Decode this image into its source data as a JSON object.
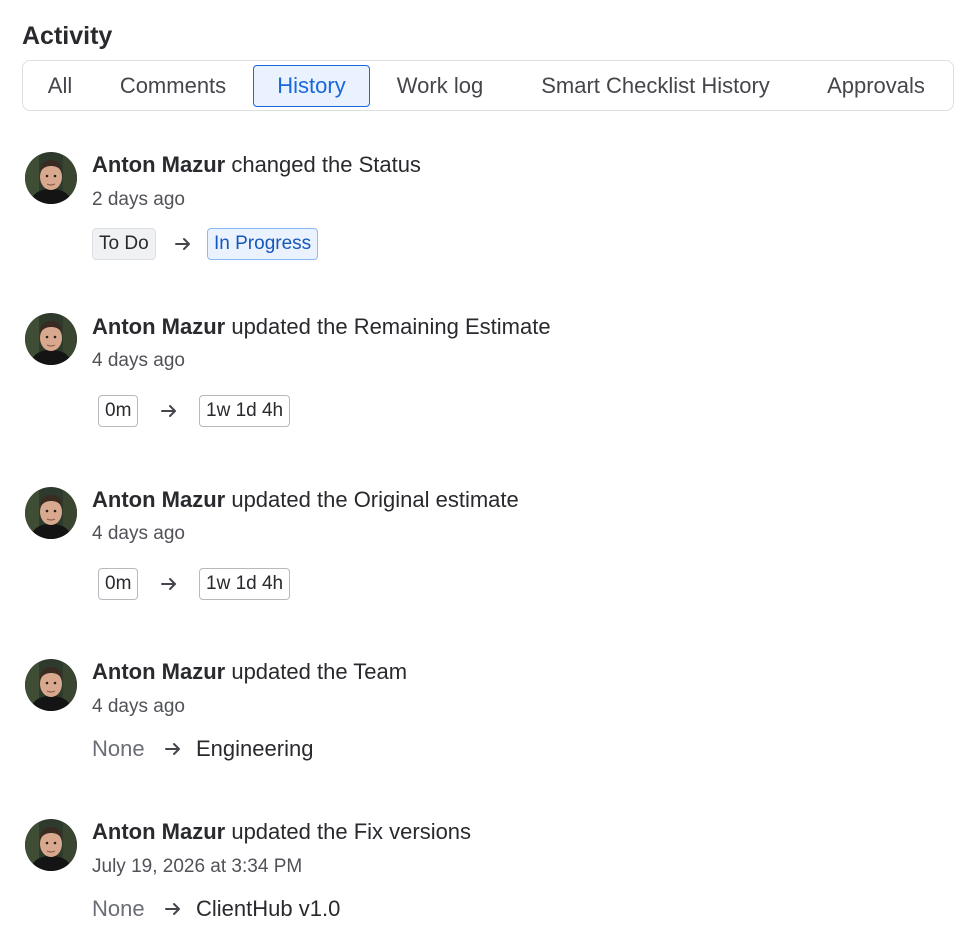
{
  "activity": {
    "title": "Activity",
    "tabs": [
      {
        "label": "All"
      },
      {
        "label": "Comments"
      },
      {
        "label": "History"
      },
      {
        "label": "Work log"
      },
      {
        "label": "Smart Checklist History"
      },
      {
        "label": "Approvals"
      }
    ],
    "active_tab": "History"
  },
  "entries": [
    {
      "actor": "Anton Mazur",
      "action": "changed the",
      "field": "Status",
      "time": "2 days ago",
      "from": "To Do",
      "to": "In Progress"
    },
    {
      "actor": "Anton Mazur",
      "action": "updated the",
      "field": "Remaining Estimate",
      "time": "4 days ago",
      "from": "0m",
      "to": "1w 1d 4h"
    },
    {
      "actor": "Anton Mazur",
      "action": "updated the",
      "field": "Original estimate",
      "time": "4 days ago",
      "from": "0m",
      "to": "1w 1d 4h"
    },
    {
      "actor": "Anton Mazur",
      "action": "updated the",
      "field": "Team",
      "time": "4 days ago",
      "from": "None",
      "to": "Engineering"
    },
    {
      "actor": "Anton Mazur",
      "action": "updated the",
      "field": "Fix versions",
      "time": "July 19, 2026 at 3:34 PM",
      "from": "None",
      "to": "ClientHub v1.0"
    }
  ],
  "colors": {
    "accent": "#1868db",
    "accent_bg": "#e9f2fe",
    "text": "#292a2e",
    "subtle": "#505258"
  },
  "icons": {
    "arrow": "arrow-right-icon",
    "avatar": "user-avatar"
  }
}
